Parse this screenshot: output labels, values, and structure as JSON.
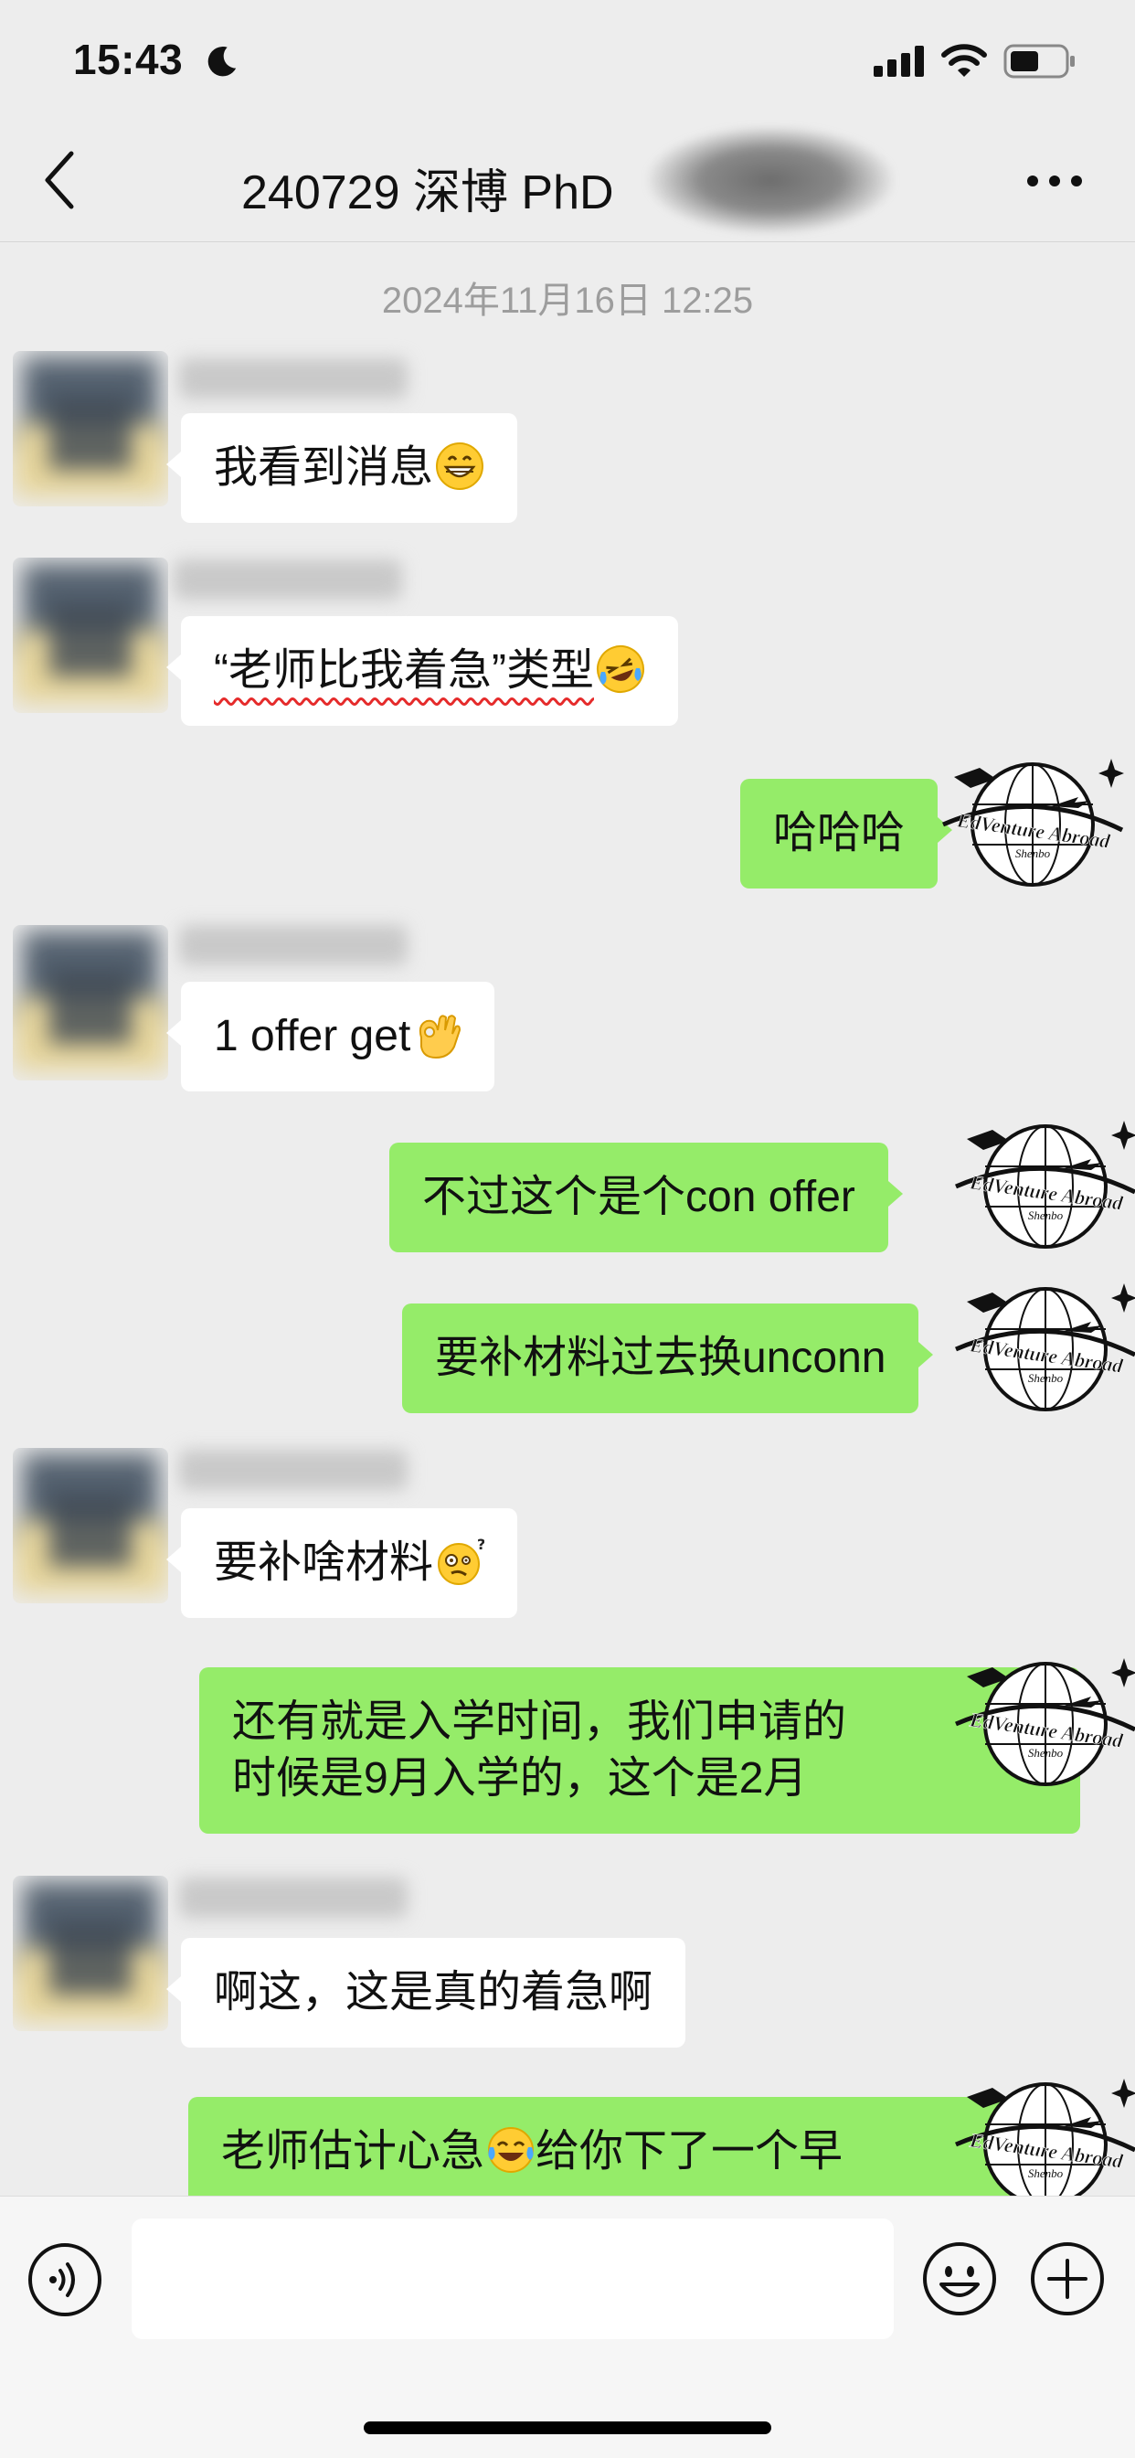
{
  "status_bar": {
    "time": "15:43",
    "icons": [
      "moon-icon",
      "signal-icon",
      "wifi-icon",
      "battery-icon"
    ]
  },
  "nav": {
    "title": "240729 深博 PhD",
    "icons": [
      "back-icon",
      "more-icon"
    ]
  },
  "chat": {
    "timestamp": "2024年11月16日 12:25",
    "messages": [
      {
        "side": "left",
        "text": "我看到消息",
        "emoji": "grinning-face"
      },
      {
        "side": "left",
        "text": "“老师比我着急”类型",
        "emoji": "crying-laughing-face"
      },
      {
        "side": "right",
        "text": "哈哈哈"
      },
      {
        "side": "left",
        "text": "1 offer get",
        "emoji": "ok-hand"
      },
      {
        "side": "right",
        "text": "不过这个是个con offer"
      },
      {
        "side": "right",
        "text": "要补材料过去换unconn"
      },
      {
        "side": "left",
        "text": "要补啥材料",
        "emoji": "confused-face"
      },
      {
        "side": "right",
        "line1": "还有就是入学时间，我们申请的",
        "line2": "时候是9月入学的，这个是2月"
      },
      {
        "side": "left",
        "text": "啊这，这是真的着急啊"
      },
      {
        "side": "right",
        "before": "老师估计心急",
        "after": "给你下了一个早",
        "emoji": "tears-of-joy"
      }
    ],
    "logo_text": "EdVenture Abroad",
    "logo_subtext": "Shenbo"
  },
  "input_bar": {
    "placeholder": "",
    "icons": [
      "voice-icon",
      "emoji-icon",
      "plus-icon"
    ]
  },
  "colors": {
    "background": "#ededed",
    "bubble_right": "#95ec69",
    "bubble_left": "#ffffff",
    "underline": "#e52b2b"
  }
}
